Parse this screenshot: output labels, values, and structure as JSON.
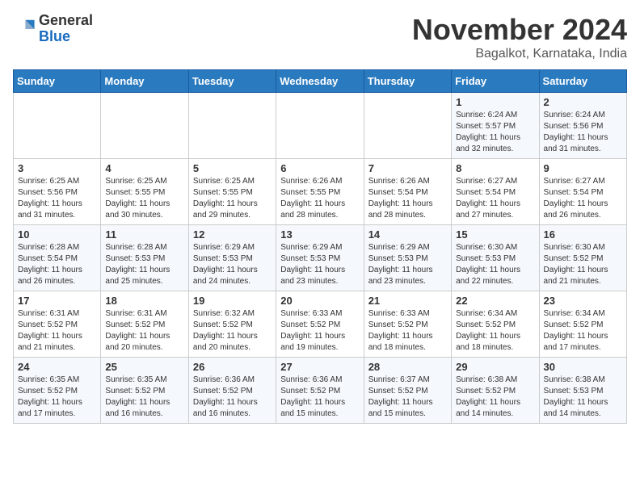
{
  "header": {
    "logo_line1": "General",
    "logo_line2": "Blue",
    "month": "November 2024",
    "location": "Bagalkot, Karnataka, India"
  },
  "days_of_week": [
    "Sunday",
    "Monday",
    "Tuesday",
    "Wednesday",
    "Thursday",
    "Friday",
    "Saturday"
  ],
  "weeks": [
    [
      {
        "day": "",
        "info": ""
      },
      {
        "day": "",
        "info": ""
      },
      {
        "day": "",
        "info": ""
      },
      {
        "day": "",
        "info": ""
      },
      {
        "day": "",
        "info": ""
      },
      {
        "day": "1",
        "info": "Sunrise: 6:24 AM\nSunset: 5:57 PM\nDaylight: 11 hours and 32 minutes."
      },
      {
        "day": "2",
        "info": "Sunrise: 6:24 AM\nSunset: 5:56 PM\nDaylight: 11 hours and 31 minutes."
      }
    ],
    [
      {
        "day": "3",
        "info": "Sunrise: 6:25 AM\nSunset: 5:56 PM\nDaylight: 11 hours and 31 minutes."
      },
      {
        "day": "4",
        "info": "Sunrise: 6:25 AM\nSunset: 5:55 PM\nDaylight: 11 hours and 30 minutes."
      },
      {
        "day": "5",
        "info": "Sunrise: 6:25 AM\nSunset: 5:55 PM\nDaylight: 11 hours and 29 minutes."
      },
      {
        "day": "6",
        "info": "Sunrise: 6:26 AM\nSunset: 5:55 PM\nDaylight: 11 hours and 28 minutes."
      },
      {
        "day": "7",
        "info": "Sunrise: 6:26 AM\nSunset: 5:54 PM\nDaylight: 11 hours and 28 minutes."
      },
      {
        "day": "8",
        "info": "Sunrise: 6:27 AM\nSunset: 5:54 PM\nDaylight: 11 hours and 27 minutes."
      },
      {
        "day": "9",
        "info": "Sunrise: 6:27 AM\nSunset: 5:54 PM\nDaylight: 11 hours and 26 minutes."
      }
    ],
    [
      {
        "day": "10",
        "info": "Sunrise: 6:28 AM\nSunset: 5:54 PM\nDaylight: 11 hours and 26 minutes."
      },
      {
        "day": "11",
        "info": "Sunrise: 6:28 AM\nSunset: 5:53 PM\nDaylight: 11 hours and 25 minutes."
      },
      {
        "day": "12",
        "info": "Sunrise: 6:29 AM\nSunset: 5:53 PM\nDaylight: 11 hours and 24 minutes."
      },
      {
        "day": "13",
        "info": "Sunrise: 6:29 AM\nSunset: 5:53 PM\nDaylight: 11 hours and 23 minutes."
      },
      {
        "day": "14",
        "info": "Sunrise: 6:29 AM\nSunset: 5:53 PM\nDaylight: 11 hours and 23 minutes."
      },
      {
        "day": "15",
        "info": "Sunrise: 6:30 AM\nSunset: 5:53 PM\nDaylight: 11 hours and 22 minutes."
      },
      {
        "day": "16",
        "info": "Sunrise: 6:30 AM\nSunset: 5:52 PM\nDaylight: 11 hours and 21 minutes."
      }
    ],
    [
      {
        "day": "17",
        "info": "Sunrise: 6:31 AM\nSunset: 5:52 PM\nDaylight: 11 hours and 21 minutes."
      },
      {
        "day": "18",
        "info": "Sunrise: 6:31 AM\nSunset: 5:52 PM\nDaylight: 11 hours and 20 minutes."
      },
      {
        "day": "19",
        "info": "Sunrise: 6:32 AM\nSunset: 5:52 PM\nDaylight: 11 hours and 20 minutes."
      },
      {
        "day": "20",
        "info": "Sunrise: 6:33 AM\nSunset: 5:52 PM\nDaylight: 11 hours and 19 minutes."
      },
      {
        "day": "21",
        "info": "Sunrise: 6:33 AM\nSunset: 5:52 PM\nDaylight: 11 hours and 18 minutes."
      },
      {
        "day": "22",
        "info": "Sunrise: 6:34 AM\nSunset: 5:52 PM\nDaylight: 11 hours and 18 minutes."
      },
      {
        "day": "23",
        "info": "Sunrise: 6:34 AM\nSunset: 5:52 PM\nDaylight: 11 hours and 17 minutes."
      }
    ],
    [
      {
        "day": "24",
        "info": "Sunrise: 6:35 AM\nSunset: 5:52 PM\nDaylight: 11 hours and 17 minutes."
      },
      {
        "day": "25",
        "info": "Sunrise: 6:35 AM\nSunset: 5:52 PM\nDaylight: 11 hours and 16 minutes."
      },
      {
        "day": "26",
        "info": "Sunrise: 6:36 AM\nSunset: 5:52 PM\nDaylight: 11 hours and 16 minutes."
      },
      {
        "day": "27",
        "info": "Sunrise: 6:36 AM\nSunset: 5:52 PM\nDaylight: 11 hours and 15 minutes."
      },
      {
        "day": "28",
        "info": "Sunrise: 6:37 AM\nSunset: 5:52 PM\nDaylight: 11 hours and 15 minutes."
      },
      {
        "day": "29",
        "info": "Sunrise: 6:38 AM\nSunset: 5:52 PM\nDaylight: 11 hours and 14 minutes."
      },
      {
        "day": "30",
        "info": "Sunrise: 6:38 AM\nSunset: 5:53 PM\nDaylight: 11 hours and 14 minutes."
      }
    ]
  ]
}
